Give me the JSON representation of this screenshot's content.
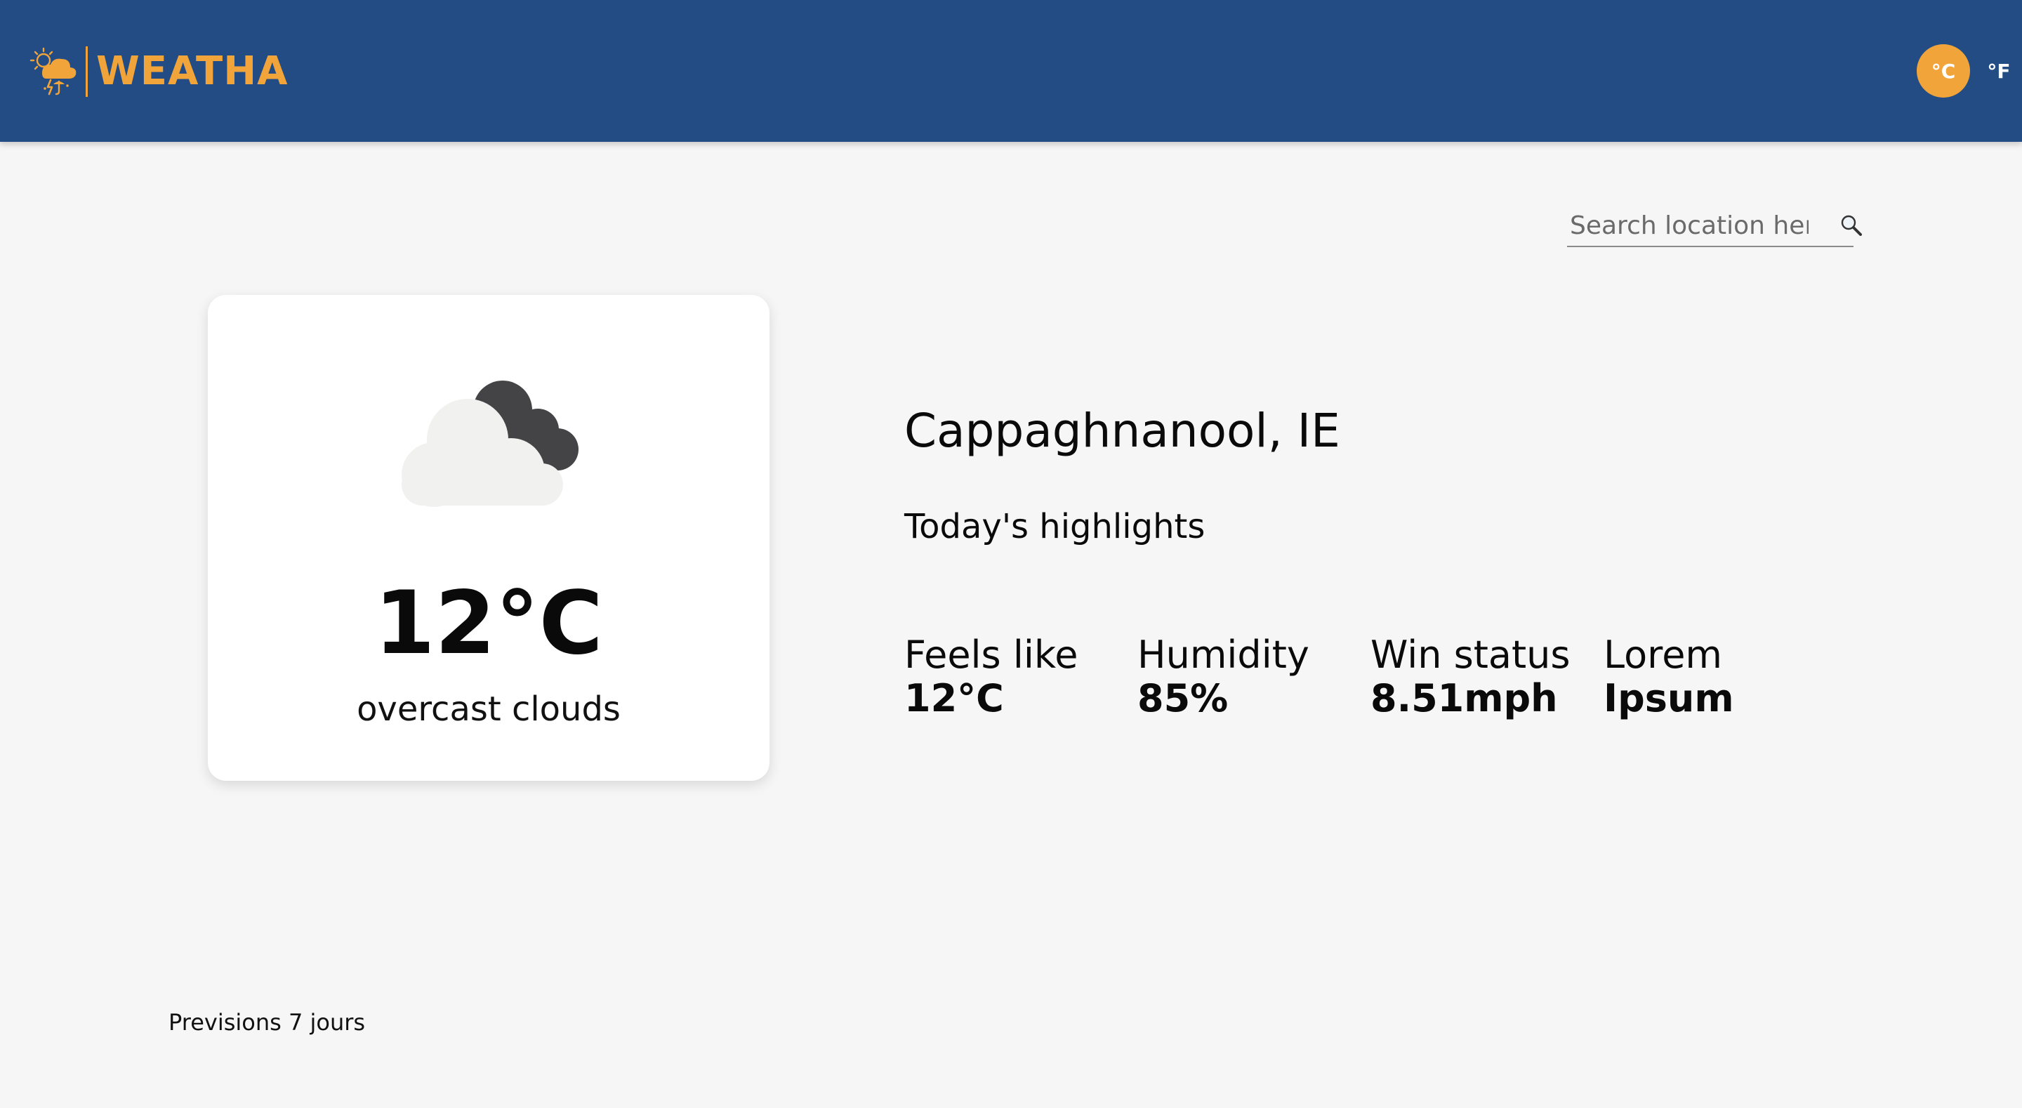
{
  "header": {
    "brand_name": "WEATHA",
    "unit_celsius": "°C",
    "unit_fahrenheit": "°F",
    "accent_color": "#f0a43a",
    "background_color": "#234c84"
  },
  "search": {
    "placeholder": "Search location here"
  },
  "current": {
    "icon": "overcast-clouds-icon",
    "temperature": "12°C",
    "condition": "overcast clouds"
  },
  "location": {
    "name": "Cappaghnanool, IE"
  },
  "highlights": {
    "title": "Today's highlights",
    "items": [
      {
        "label": "Feels like",
        "value": "12°C"
      },
      {
        "label": "Humidity",
        "value": "85%"
      },
      {
        "label": "Win status",
        "value": "8.51mph"
      },
      {
        "label": "Lorem",
        "value": "Ipsum"
      }
    ]
  },
  "forecast": {
    "title": "Previsions 7 jours"
  }
}
